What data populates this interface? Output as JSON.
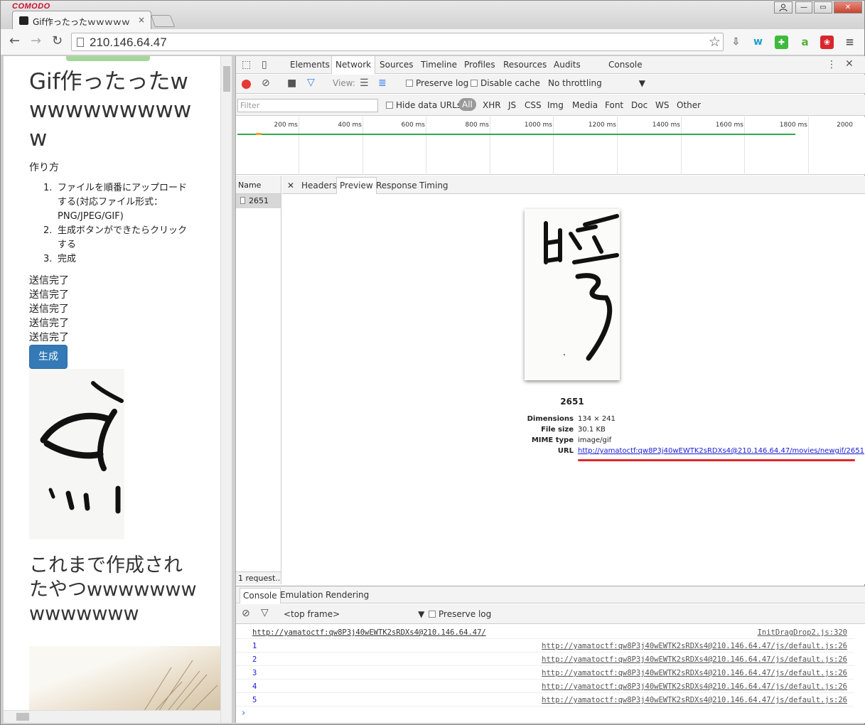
{
  "browser": {
    "brand": "COMODO",
    "tab_title": "Gif作ったったｗｗｗｗｗ",
    "tab_close": "×",
    "url": "210.146.64.47",
    "window_buttons": {
      "min": "—",
      "max": "▭",
      "close": "✕"
    }
  },
  "page": {
    "heading": "Gif作ったったwwwwwwwwwww",
    "howto": "作り方",
    "steps": [
      {
        "num": "1.",
        "text": "ファイルを順番にアップロードする(対応ファイル形式：PNG/JPEG/GIF)"
      },
      {
        "num": "2.",
        "text": "生成ボタンができたらクリックする"
      },
      {
        "num": "3.",
        "text": "完成"
      }
    ],
    "sent_lines": [
      "送信完了",
      "送信完了",
      "送信完了",
      "送信完了",
      "送信完了"
    ],
    "generate_button": "生成",
    "heading2": "これまで作成されたやつwwwwwwwwwwwwww"
  },
  "devtools": {
    "tabs": [
      "Elements",
      "Network",
      "Sources",
      "Timeline",
      "Profiles",
      "Resources",
      "Audits",
      "Console"
    ],
    "active_tab": "Network",
    "toolbar": {
      "view_label": "View:",
      "preserve_log": "Preserve log",
      "disable_cache": "Disable cache",
      "throttling": "No throttling"
    },
    "filter": {
      "placeholder": "Filter",
      "hide_data_urls": "Hide data URLs",
      "types": [
        "All",
        "XHR",
        "JS",
        "CSS",
        "Img",
        "Media",
        "Font",
        "Doc",
        "WS",
        "Other"
      ]
    },
    "timeline_labels": [
      "200 ms",
      "400 ms",
      "600 ms",
      "800 ms",
      "1000 ms",
      "1200 ms",
      "1400 ms",
      "1600 ms",
      "1800 ms",
      "2000"
    ],
    "requests": {
      "header": "Name",
      "items": [
        "2651"
      ],
      "footer": "1 request..."
    },
    "detail_tabs": [
      "Headers",
      "Preview",
      "Response",
      "Timing"
    ],
    "active_detail_tab": "Preview",
    "preview": {
      "name": "2651",
      "dimensions_label": "Dimensions",
      "dimensions": "134 × 241",
      "file_size_label": "File size",
      "file_size": "30.1 KB",
      "mime_label": "MIME type",
      "mime": "image/gif",
      "url_label": "URL",
      "url": "http://yamatoctf:qw8P3j40wEWTK2sRDXs4@210.146.64.47/movies/newgif/2651"
    },
    "drawer": {
      "tabs": [
        "Console",
        "Emulation",
        "Rendering"
      ],
      "frame": "<top frame>",
      "preserve_log": "Preserve log",
      "lines": [
        {
          "msg": "http://yamatoctf:qw8P3j40wEWTK2sRDXs4@210.146.64.47/",
          "src": "InitDragDrop2.js:320",
          "is_link": true
        },
        {
          "msg": "1",
          "src": "http://yamatoctf:qw8P3j40wEWTK2sRDXs4@210.146.64.47/js/default.js:26"
        },
        {
          "msg": "2",
          "src": "http://yamatoctf:qw8P3j40wEWTK2sRDXs4@210.146.64.47/js/default.js:26"
        },
        {
          "msg": "3",
          "src": "http://yamatoctf:qw8P3j40wEWTK2sRDXs4@210.146.64.47/js/default.js:26"
        },
        {
          "msg": "4",
          "src": "http://yamatoctf:qw8P3j40wEWTK2sRDXs4@210.146.64.47/js/default.js:26"
        },
        {
          "msg": "5",
          "src": "http://yamatoctf:qw8P3j40wEWTK2sRDXs4@210.146.64.47/js/default.js:26"
        }
      ],
      "prompt": "›"
    }
  },
  "colors": {
    "accent_blue": "#337ab7",
    "record_red": "#e53935",
    "timeline_green": "#2eaa4a",
    "highlight_red": "#e0262b"
  }
}
